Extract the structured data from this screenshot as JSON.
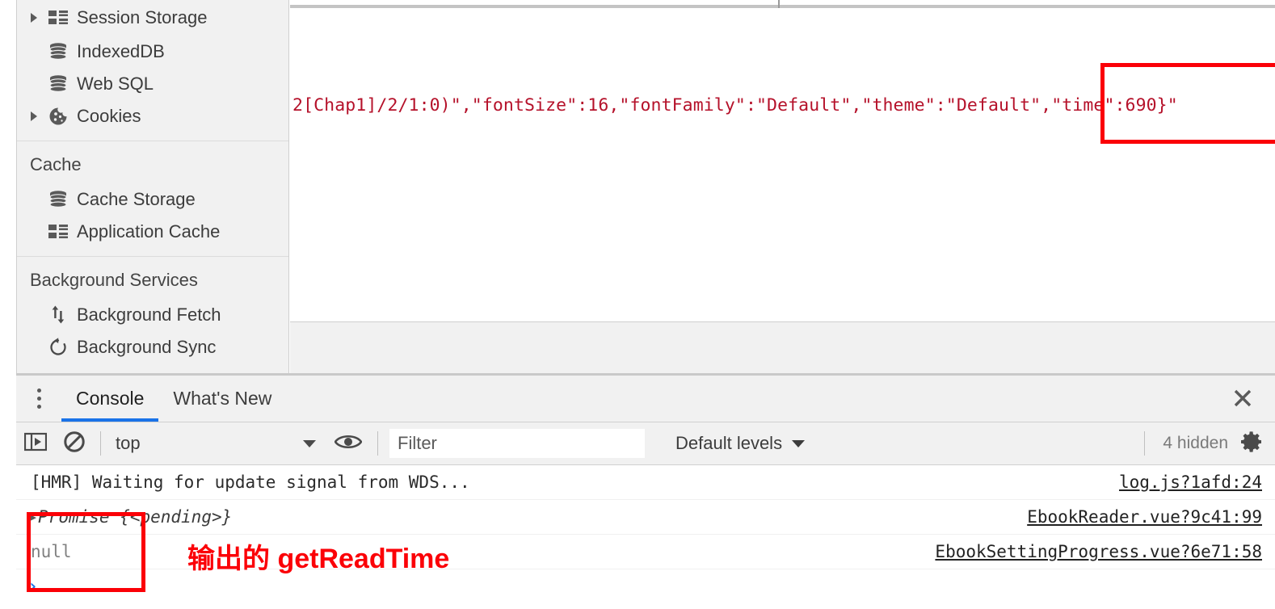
{
  "sidebar": {
    "groups": [
      {
        "title": null,
        "items": [
          {
            "label": "Session Storage",
            "icon": "grid-icon",
            "expandable": true
          },
          {
            "label": "IndexedDB",
            "icon": "database-icon",
            "expandable": false
          },
          {
            "label": "Web SQL",
            "icon": "database-icon",
            "expandable": false
          },
          {
            "label": "Cookies",
            "icon": "cookie-icon",
            "expandable": true
          }
        ]
      },
      {
        "title": "Cache",
        "items": [
          {
            "label": "Cache Storage",
            "icon": "database-icon",
            "expandable": false
          },
          {
            "label": "Application Cache",
            "icon": "grid-icon",
            "expandable": false
          }
        ]
      },
      {
        "title": "Background Services",
        "items": [
          {
            "label": "Background Fetch",
            "icon": "updown-arrows-icon",
            "expandable": false
          },
          {
            "label": "Background Sync",
            "icon": "refresh-icon",
            "expandable": false
          }
        ]
      }
    ]
  },
  "content": {
    "value_text": "'2[Chap1]/2/1:0)\",\"fontSize\":16,\"fontFamily\":\"Default\",\"theme\":\"Default\",\"time\":690}\""
  },
  "drawer": {
    "tabs": [
      {
        "label": "Console",
        "active": true
      },
      {
        "label": "What's New",
        "active": false
      }
    ],
    "close_label": "×"
  },
  "console_toolbar": {
    "execute_icon": "sidebar-toggle-icon",
    "clear_icon": "clear-console-icon",
    "context": "top",
    "eye_icon": "live-expression-icon",
    "filter_placeholder": "Filter",
    "filter_value": "",
    "levels_label": "Default levels",
    "hidden_label": "4 hidden",
    "settings_icon": "gear-icon"
  },
  "console_messages": [
    {
      "arrow": "",
      "text": "[HMR] Waiting for update signal from WDS...",
      "style": "plain",
      "source": "log.js?1afd:24"
    },
    {
      "arrow": "▶",
      "text": "Promise {<pending>}",
      "style": "pending",
      "source": "EbookReader.vue?9c41:99"
    },
    {
      "arrow": "",
      "text": "null",
      "style": "null",
      "source": "EbookSettingProgress.vue?6e71:58"
    }
  ],
  "console_prompt": {
    "caret": "›"
  },
  "annotations": {
    "box_time_name": "time-value-highlight",
    "box_null_name": "null-output-highlight",
    "label": "输出的 getReadTime",
    "color": "#fb0007"
  }
}
